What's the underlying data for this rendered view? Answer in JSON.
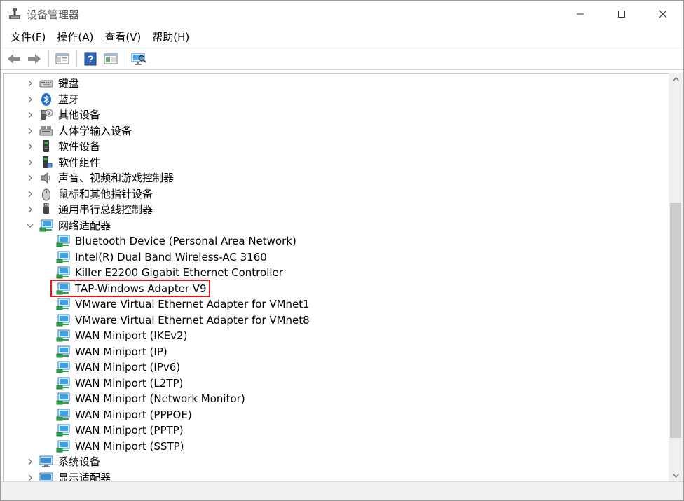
{
  "window": {
    "title": "设备管理器",
    "controls": {
      "minimize": "minimize",
      "maximize": "maximize",
      "close": "close"
    }
  },
  "menu": {
    "items": [
      "文件(F)",
      "操作(A)",
      "查看(V)",
      "帮助(H)"
    ]
  },
  "toolbar": {
    "buttons": [
      "back-icon",
      "forward-icon",
      "properties-icon",
      "help-icon",
      "view-icon",
      "scan-hardware-icon"
    ]
  },
  "tree": {
    "categories": [
      {
        "label": "键盘",
        "icon": "keyboard-icon",
        "expanded": false
      },
      {
        "label": "蓝牙",
        "icon": "bluetooth-icon",
        "expanded": false
      },
      {
        "label": "其他设备",
        "icon": "other-devices-icon",
        "expanded": false
      },
      {
        "label": "人体学输入设备",
        "icon": "hid-icon",
        "expanded": false
      },
      {
        "label": "软件设备",
        "icon": "software-device-icon",
        "expanded": false
      },
      {
        "label": "软件组件",
        "icon": "software-component-icon",
        "expanded": false
      },
      {
        "label": "声音、视频和游戏控制器",
        "icon": "audio-icon",
        "expanded": false
      },
      {
        "label": "鼠标和其他指针设备",
        "icon": "mouse-icon",
        "expanded": false
      },
      {
        "label": "通用串行总线控制器",
        "icon": "usb-icon",
        "expanded": false
      },
      {
        "label": "网络适配器",
        "icon": "network-adapter-icon",
        "expanded": true
      }
    ],
    "network_adapters": [
      "Bluetooth Device (Personal Area Network)",
      "Intel(R) Dual Band Wireless-AC 3160",
      "Killer E2200 Gigabit Ethernet Controller",
      "TAP-Windows Adapter V9",
      "VMware Virtual Ethernet Adapter for VMnet1",
      "VMware Virtual Ethernet Adapter for VMnet8",
      "WAN Miniport (IKEv2)",
      "WAN Miniport (IP)",
      "WAN Miniport (IPv6)",
      "WAN Miniport (L2TP)",
      "WAN Miniport (Network Monitor)",
      "WAN Miniport (PPPOE)",
      "WAN Miniport (PPTP)",
      "WAN Miniport (SSTP)"
    ],
    "after_categories": [
      {
        "label": "系统设备",
        "icon": "system-devices-icon",
        "expanded": false
      },
      {
        "label": "显示适配器",
        "icon": "display-adapter-icon",
        "expanded": false
      }
    ]
  },
  "highlight": {
    "target": "TAP-Windows Adapter V9",
    "color": "#e0161d"
  },
  "colors": {
    "accent": "#1f8fd6",
    "network_icon_green": "#2aa14a"
  }
}
